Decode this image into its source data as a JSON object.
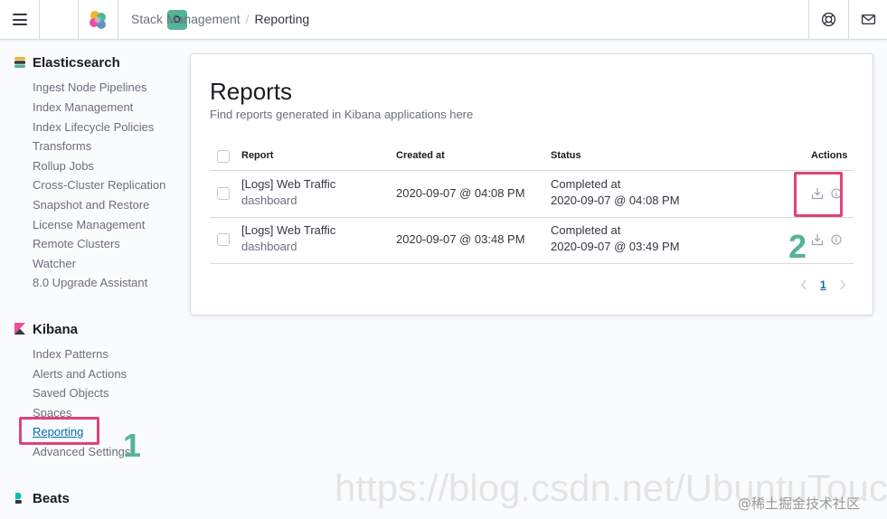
{
  "header": {
    "space_initial": "D",
    "breadcrumbs": [
      "Stack Management",
      "Reporting"
    ]
  },
  "sidebar": {
    "sections": [
      {
        "title": "Elasticsearch",
        "icon": "elasticsearch-icon",
        "items": [
          "Ingest Node Pipelines",
          "Index Management",
          "Index Lifecycle Policies",
          "Transforms",
          "Rollup Jobs",
          "Cross-Cluster Replication",
          "Snapshot and Restore",
          "License Management",
          "Remote Clusters",
          "Watcher",
          "8.0 Upgrade Assistant"
        ]
      },
      {
        "title": "Kibana",
        "icon": "kibana-icon",
        "items": [
          "Index Patterns",
          "Alerts and Actions",
          "Saved Objects",
          "Spaces",
          "Reporting",
          "Advanced Settings"
        ],
        "active": "Reporting"
      },
      {
        "title": "Beats",
        "icon": "beats-icon",
        "items": []
      }
    ]
  },
  "main": {
    "title": "Reports",
    "subtitle": "Find reports generated in Kibana applications here",
    "table": {
      "columns": [
        "Report",
        "Created at",
        "Status",
        "Actions"
      ],
      "rows": [
        {
          "title": "[Logs] Web Traffic",
          "type": "dashboard",
          "created": "2020-09-07 @ 04:08 PM",
          "status": "Completed at",
          "status_time": "2020-09-07 @ 04:08 PM"
        },
        {
          "title": "[Logs] Web Traffic",
          "type": "dashboard",
          "created": "2020-09-07 @ 03:48 PM",
          "status": "Completed at",
          "status_time": "2020-09-07 @ 03:49 PM"
        }
      ]
    },
    "pagination": {
      "current_page": "1"
    }
  },
  "annotations": {
    "step1": "1",
    "step2": "2",
    "highlight_color": "#e0427a",
    "number_color": "#54b399"
  },
  "watermark": {
    "text": "https://blog.csdn.net/UbuntuTouch",
    "credit": "@稀土掘金技术社区"
  },
  "colors": {
    "accent": "#006bb4",
    "avatar": "#54b399"
  }
}
